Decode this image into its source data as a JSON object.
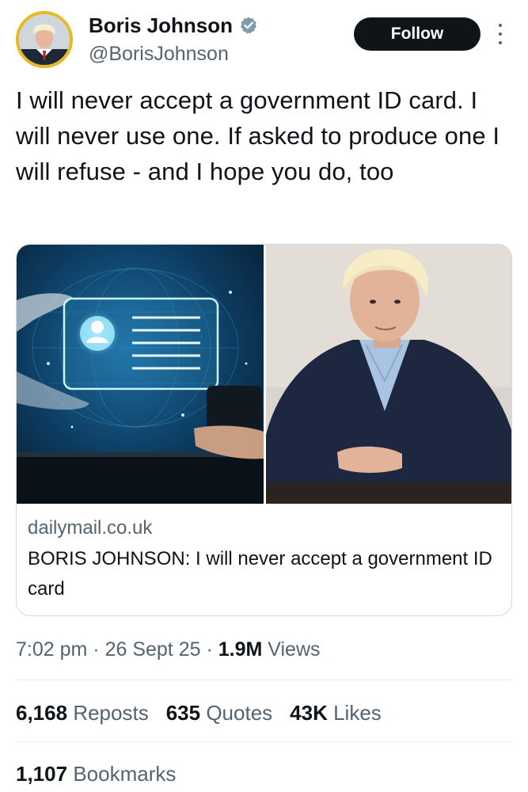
{
  "author": {
    "display_name": "Boris Johnson",
    "handle": "@BorisJohnson",
    "verified_icon": "verified-badge-icon",
    "verified_color": "#829aab"
  },
  "actions": {
    "follow_label": "Follow",
    "more_icon": "more-vertical-icon"
  },
  "tweet": {
    "text": "I will never accept a government ID card. I will never use one. If asked to produce one I will refuse - and I hope you do, too"
  },
  "link_card": {
    "domain": "dailymail.co.uk",
    "title": "BORIS JOHNSON: I will never accept a government ID card",
    "images": [
      "digital-id-card-illustration",
      "portrait-photo"
    ]
  },
  "meta": {
    "time": "7:02 pm",
    "sep1": " · ",
    "date": "26 Sept 25",
    "sep2": " · ",
    "views_count": "1.9M",
    "views_label": " Views"
  },
  "stats": {
    "reposts_count": "6,168",
    "reposts_label": "Reposts",
    "quotes_count": "635",
    "quotes_label": "Quotes",
    "likes_count": "43K",
    "likes_label": "Likes",
    "bookmarks_count": "1,107",
    "bookmarks_label": "Bookmarks"
  },
  "colors": {
    "text_primary": "#0f1419",
    "text_secondary": "#536471",
    "border": "#cfd9de",
    "avatar_ring": "#e8b923",
    "follow_bg": "#0f1419"
  }
}
